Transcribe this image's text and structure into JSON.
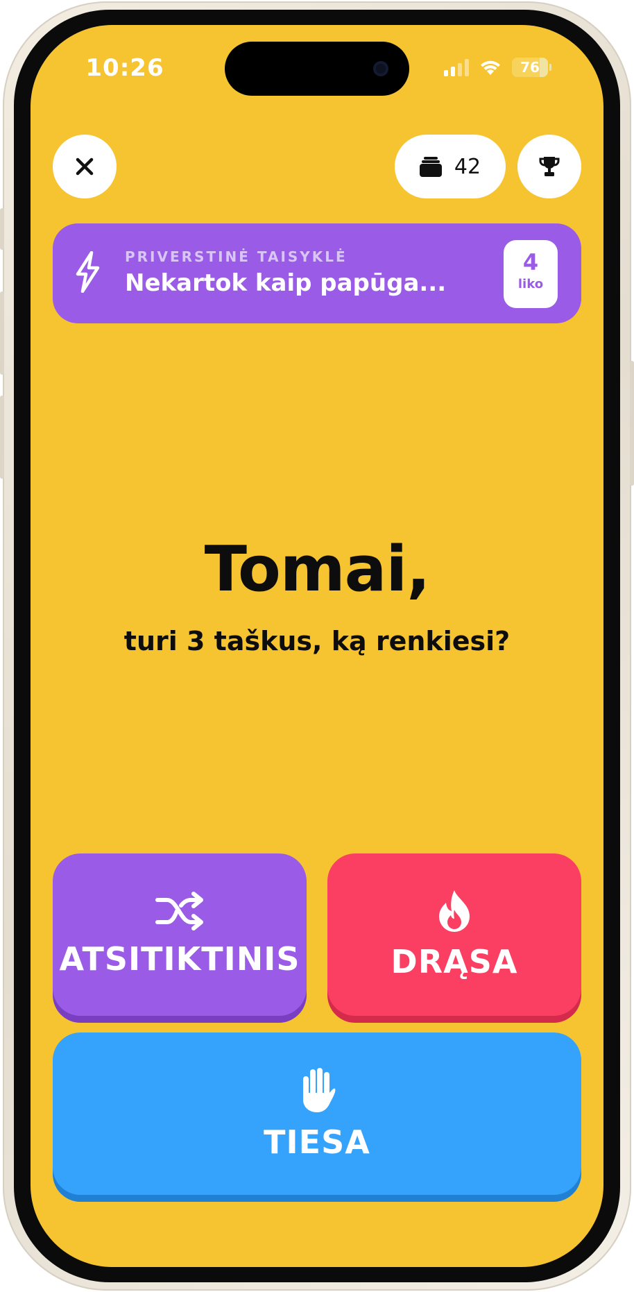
{
  "status_bar": {
    "time": "10:26",
    "battery": "76",
    "icons": [
      "cellular-signal-icon",
      "wifi-icon",
      "battery-icon"
    ]
  },
  "header": {
    "close_icon": "close-icon",
    "cards_icon": "card-stack-icon",
    "cards_count": "42",
    "trophy_icon": "trophy-icon"
  },
  "rule": {
    "icon": "lightning-bolt-icon",
    "label": "PRIVERSTINĖ TAISYKLĖ",
    "text": "Nekartok kaip papūga...",
    "remaining": "4",
    "remaining_label": "liko"
  },
  "main": {
    "player": "Tomai,",
    "prompt": "turi 3 taškus, ką renkiesi?"
  },
  "choices": {
    "random": {
      "label": "ATSITIKTINIS",
      "icon": "shuffle-icon"
    },
    "dare": {
      "label": "DRĄSA",
      "icon": "fire-icon"
    },
    "truth": {
      "label": "TIESA",
      "icon": "raised-hand-icon"
    }
  },
  "colors": {
    "background": "#f6c431",
    "purple": "#9a5ce6",
    "red": "#fb3f63",
    "blue": "#35a2fb"
  }
}
